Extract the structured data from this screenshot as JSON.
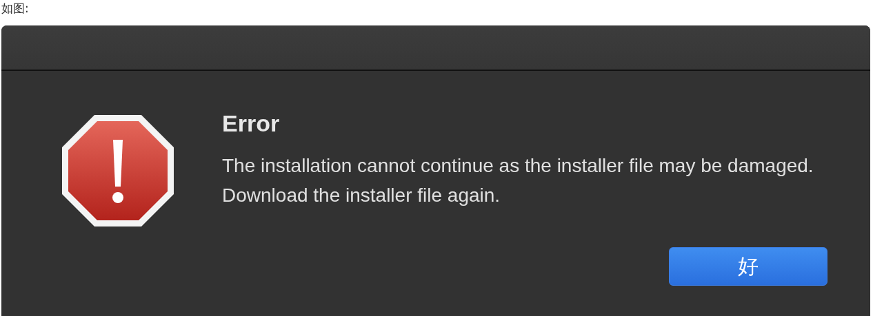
{
  "caption": "如图:",
  "dialog": {
    "title": "Error",
    "message": "The installation cannot continue as the installer file may be damaged. Download the installer file again.",
    "buttons": [
      {
        "label": "好",
        "default": true
      }
    ]
  }
}
